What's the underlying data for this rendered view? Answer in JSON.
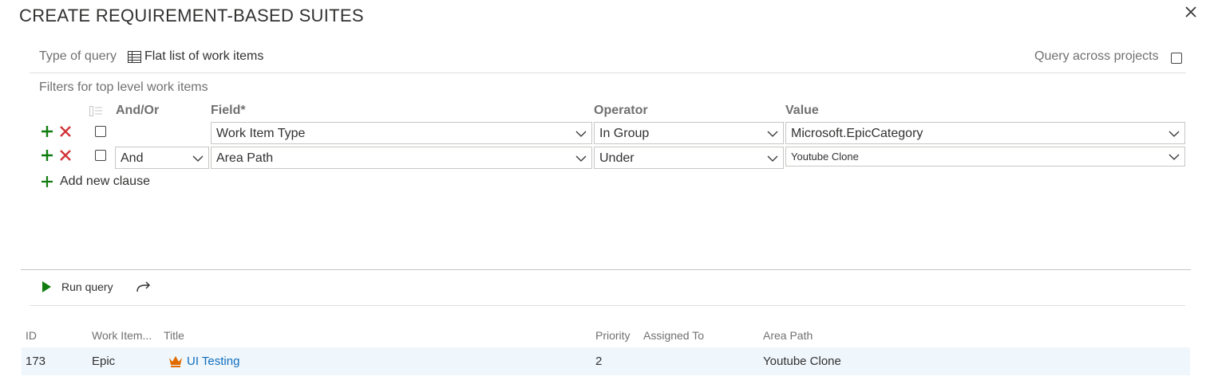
{
  "dialog": {
    "title": "CREATE REQUIREMENT-BASED SUITES",
    "close_icon": "close-icon"
  },
  "query_type": {
    "label": "Type of query",
    "value": "Flat list of work items",
    "icon": "table-list-icon"
  },
  "query_across_projects": {
    "label": "Query across projects",
    "checked": false
  },
  "filters": {
    "label": "Filters for top level work items",
    "columns": {
      "and_or": "And/Or",
      "field": "Field*",
      "operator": "Operator",
      "value": "Value"
    },
    "clauses": [
      {
        "and_or": "",
        "field": "Work Item Type",
        "operator": "In Group",
        "value": "Microsoft.EpicCategory"
      },
      {
        "and_or": "And",
        "field": "Area Path",
        "operator": "Under",
        "value": "Youtube Clone"
      }
    ],
    "add_clause_label": "Add new clause"
  },
  "toolbar": {
    "run_query_label": "Run query",
    "share_icon": "share-arrow-icon"
  },
  "results": {
    "columns": [
      "ID",
      "Work Item...",
      "Title",
      "Priority",
      "Assigned To",
      "Area Path"
    ],
    "rows": [
      {
        "id": "173",
        "type": "Epic",
        "title": "UI Testing",
        "priority": "2",
        "assigned_to": "",
        "area_path": "Youtube Clone",
        "type_icon": "crown-icon"
      }
    ]
  },
  "colors": {
    "accent_green": "#107c10",
    "delete_red": "#d13438",
    "link_blue": "#106ebe",
    "epic_orange": "#e06c00",
    "row_highlight": "#eff6fc"
  }
}
